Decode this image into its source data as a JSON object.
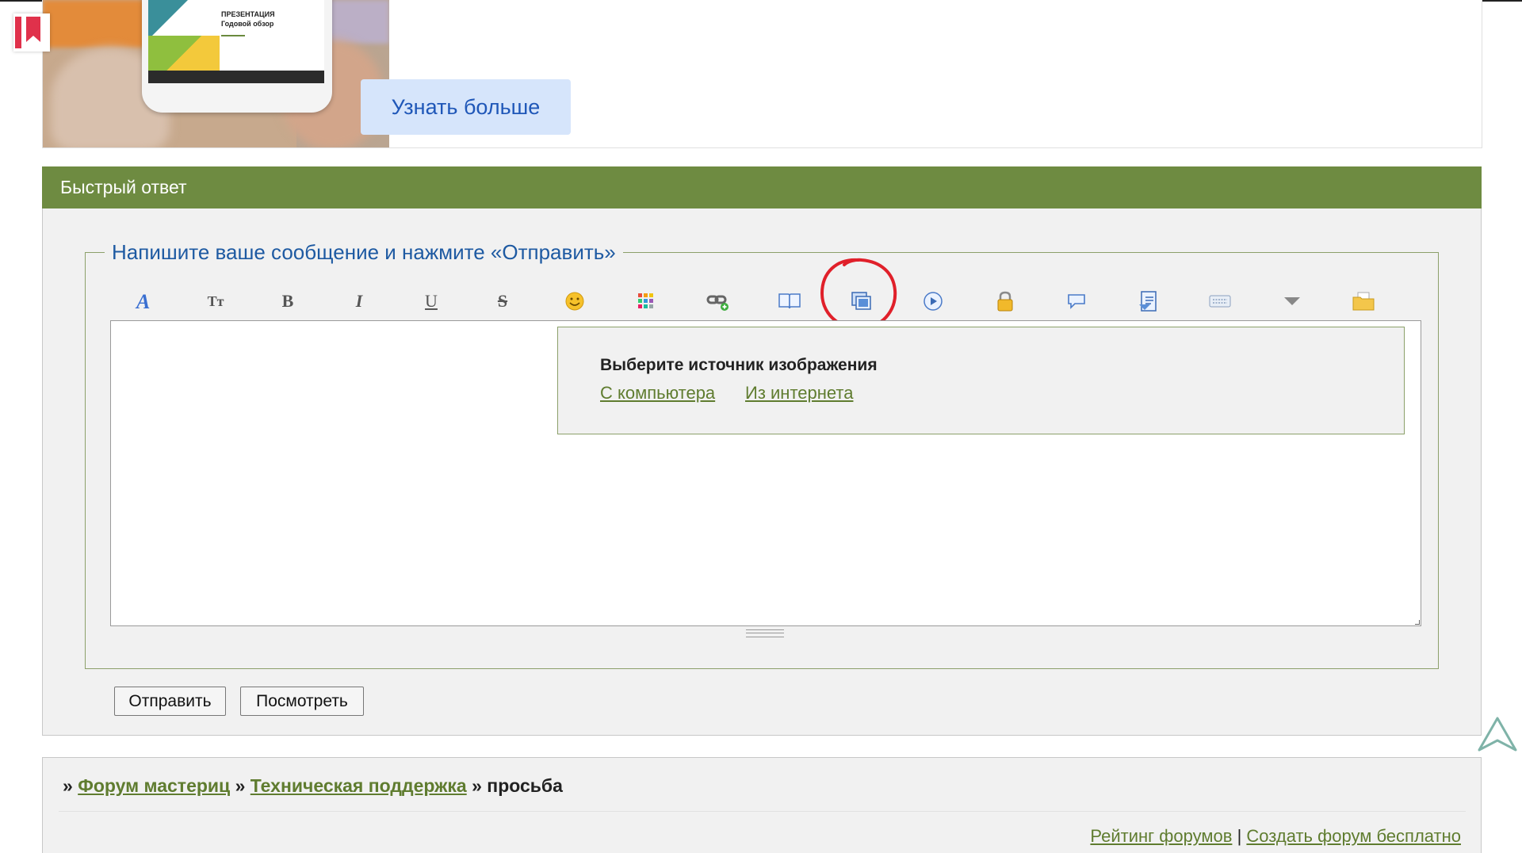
{
  "ad": {
    "phone_title_line1": "ПРЕЗЕНТАЦИЯ",
    "phone_title_line2": "Годовой обзор",
    "cta_label": "Узнать больше"
  },
  "quick_reply": {
    "header": "Быстрый ответ",
    "legend": "Напишите ваше сообщение и нажмите «Отправить»",
    "toolbar": [
      {
        "name": "font-color-icon"
      },
      {
        "name": "font-size-icon",
        "text": "Tт"
      },
      {
        "name": "bold-icon",
        "text": "B"
      },
      {
        "name": "italic-icon",
        "text": "I"
      },
      {
        "name": "underline-icon",
        "text": "U"
      },
      {
        "name": "strikethrough-icon",
        "text": "S"
      },
      {
        "name": "smiley-icon"
      },
      {
        "name": "color-palette-icon"
      },
      {
        "name": "link-icon"
      },
      {
        "name": "book-icon"
      },
      {
        "name": "image-icon"
      },
      {
        "name": "media-play-icon"
      },
      {
        "name": "lock-icon"
      },
      {
        "name": "quote-bubble-icon"
      },
      {
        "name": "code-icon"
      },
      {
        "name": "keyboard-icon"
      },
      {
        "name": "more-dropdown-icon"
      },
      {
        "name": "folder-icon"
      }
    ],
    "image_popup": {
      "title": "Выберите источник изображения",
      "from_computer": "С компьютера",
      "from_internet": "Из интернета"
    },
    "send_label": "Отправить",
    "preview_label": "Посмотреть",
    "colors": {
      "header_bg": "#6e8b41",
      "link": "#5f7c2f",
      "legend": "#1e5aa2"
    }
  },
  "breadcrumbs": {
    "prefix": "»",
    "forum": "Форум мастериц",
    "section": "Техническая поддержка",
    "current": "просьба"
  },
  "footer": {
    "rating": "Рейтинг форумов",
    "separator": "|",
    "create": "Создать форум бесплатно"
  }
}
